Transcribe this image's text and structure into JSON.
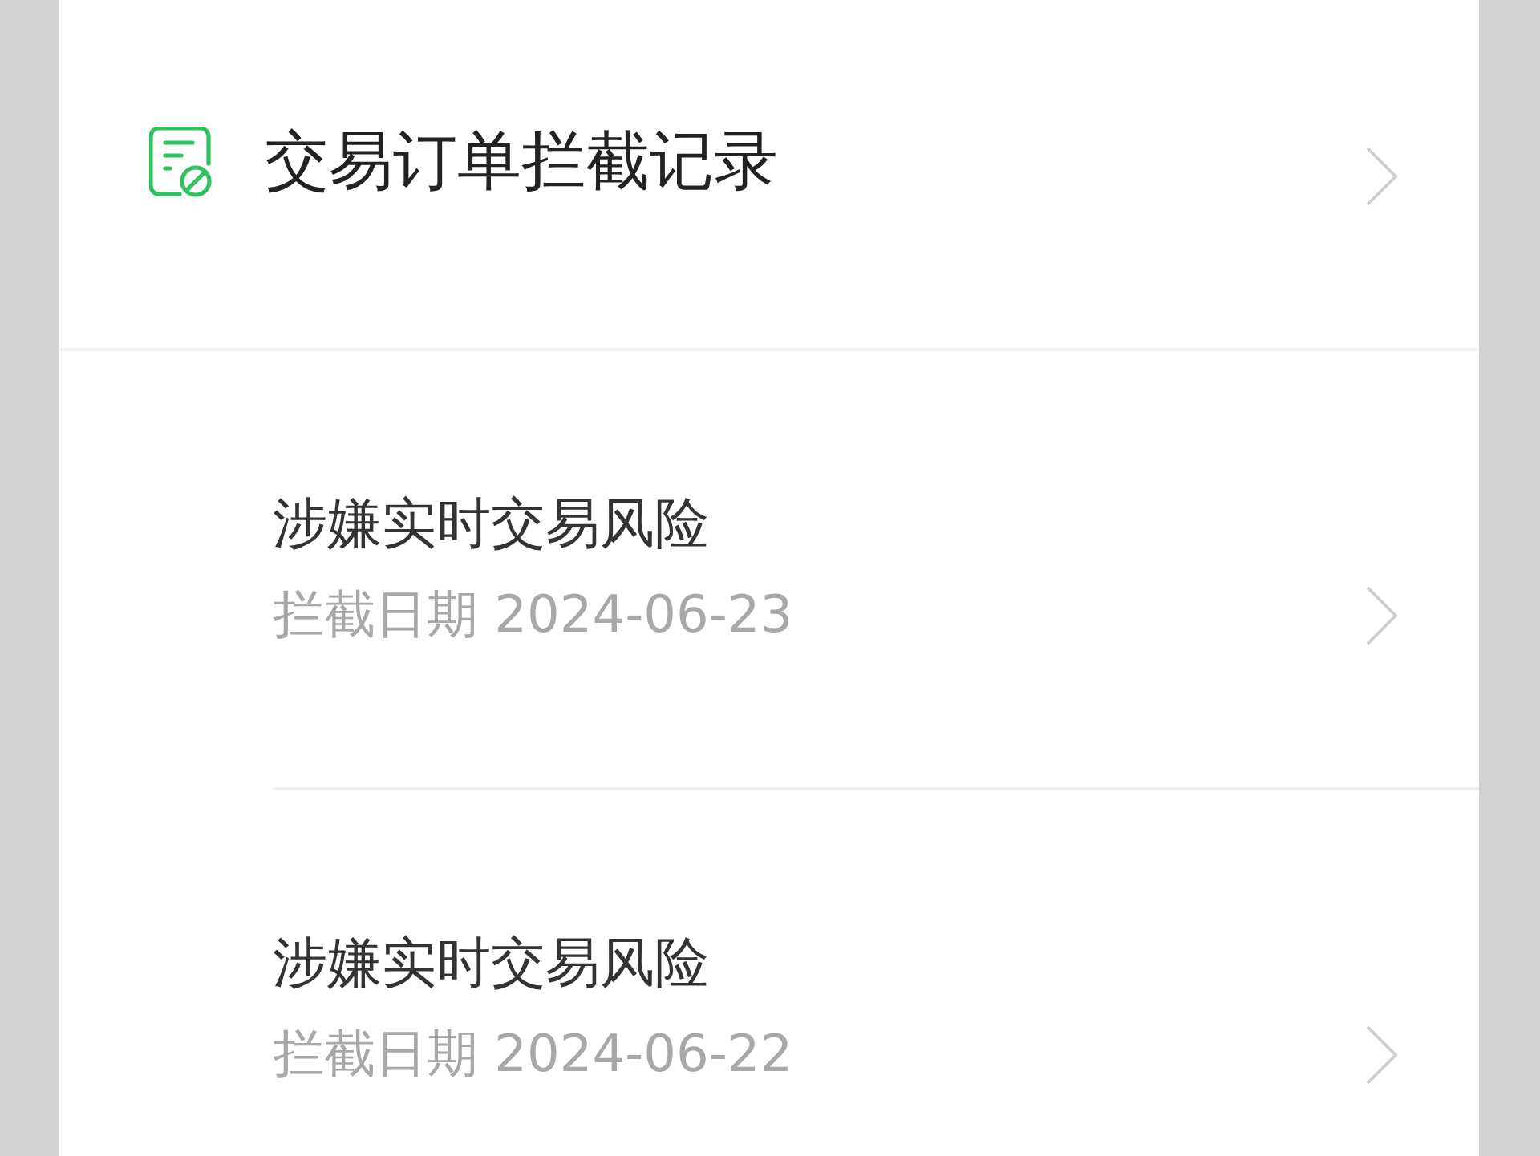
{
  "header": {
    "title": "交易订单拦截记录"
  },
  "records": [
    {
      "reason": "涉嫌实时交易风险",
      "date_label": "拦截日期 2024-06-23"
    },
    {
      "reason": "涉嫌实时交易风险",
      "date_label": "拦截日期 2024-06-22"
    }
  ]
}
